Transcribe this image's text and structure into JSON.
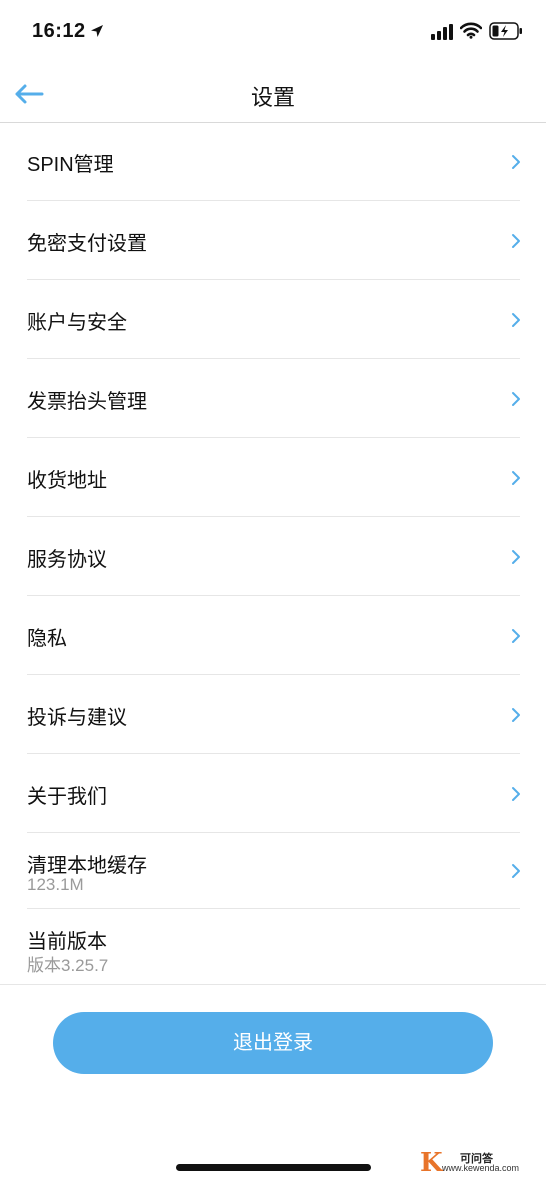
{
  "status_bar": {
    "time": "16:12",
    "icons": [
      "location-arrow-icon",
      "cellular-signal-icon",
      "wifi-icon",
      "battery-charging-icon"
    ]
  },
  "nav": {
    "title": "设置",
    "back_icon": "arrow-left-icon",
    "accent_color": "#55aeea"
  },
  "menu": {
    "items": [
      {
        "label": "SPIN管理"
      },
      {
        "label": "免密支付设置"
      },
      {
        "label": "账户与安全"
      },
      {
        "label": "发票抬头管理"
      },
      {
        "label": "收货地址"
      },
      {
        "label": "服务协议"
      },
      {
        "label": "隐私"
      },
      {
        "label": "投诉与建议"
      },
      {
        "label": "关于我们"
      },
      {
        "label": "清理本地缓存",
        "sub": "123.1M"
      },
      {
        "label": "当前版本",
        "sub": "版本3.25.7"
      }
    ],
    "chevron_icon": "chevron-right-icon"
  },
  "logout": {
    "label": "退出登录",
    "color": "#55aeea"
  },
  "watermark": {
    "logo_letter": "K",
    "name": "可问答",
    "url": "www.kewenda.com"
  }
}
